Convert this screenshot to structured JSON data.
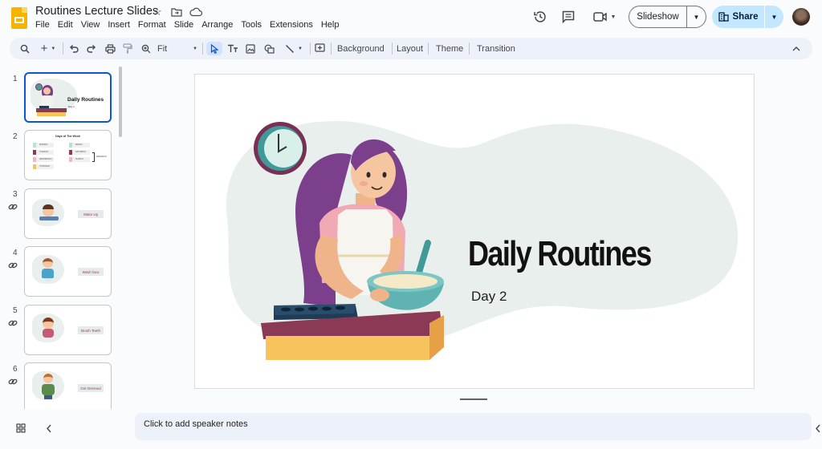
{
  "app": {
    "document_title": "Routines Lecture Slides",
    "menu": [
      "File",
      "Edit",
      "View",
      "Insert",
      "Format",
      "Slide",
      "Arrange",
      "Tools",
      "Extensions",
      "Help"
    ],
    "slideshow_label": "Slideshow",
    "share_label": "Share"
  },
  "toolbar": {
    "zoom_value": "Fit",
    "background_label": "Background",
    "layout_label": "Layout",
    "theme_label": "Theme",
    "transition_label": "Transition"
  },
  "filmstrip": {
    "slides": [
      {
        "number": "1",
        "title": "Daily Routines",
        "subtitle": "Day 2"
      },
      {
        "number": "2",
        "title": "Days of The Week",
        "days": [
          "MONDAY",
          "TUESDAY",
          "WEDNESDAY",
          "THURSDAY",
          "FRIDAY",
          "SATURDAY",
          "SUNDAY"
        ],
        "weekend": "WEEKEND"
      },
      {
        "number": "3",
        "label": "Wake Up"
      },
      {
        "number": "4",
        "label": "Wash face"
      },
      {
        "number": "5",
        "label": "Brush Teeth"
      },
      {
        "number": "6",
        "label": "Get Dressed"
      }
    ]
  },
  "slide": {
    "title": "Daily Routines",
    "subtitle": "Day 2"
  },
  "notes": {
    "placeholder": "Click to add speaker notes"
  },
  "colors": {
    "accent_blue": "#0b57d0",
    "share_bg": "#c2e7ff",
    "toolbar_bg": "#edf2fa",
    "blob": "#e8efec",
    "purple_hair": "#7b3f8c",
    "counter_red": "#8b3a55",
    "counter_yellow": "#f6c35c"
  }
}
